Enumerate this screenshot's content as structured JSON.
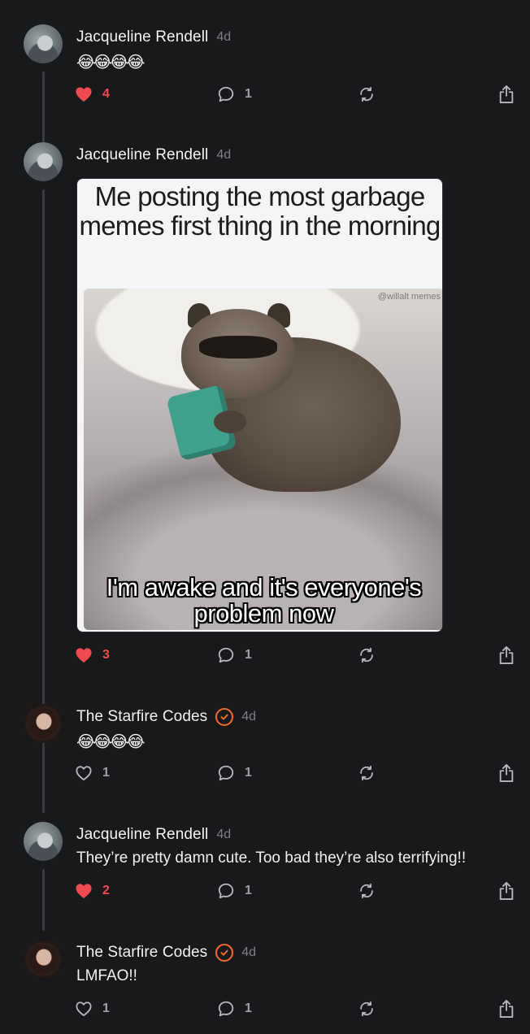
{
  "colors": {
    "background": "#18191b",
    "like_active": "#ef4a4f",
    "verified": "#f26a2b",
    "muted": "#7d7f84"
  },
  "posts": [
    {
      "author": "Jacqueline Rendell",
      "time": "4d",
      "text": "😂😂😂😂",
      "likes": "4",
      "replies": "1",
      "liked": true,
      "verified": false
    },
    {
      "author": "Jacqueline Rendell",
      "time": "4d",
      "text": "",
      "likes": "3",
      "replies": "1",
      "liked": true,
      "verified": false,
      "image": {
        "top_caption": "Me posting the most garbage memes first thing in the morning",
        "watermark": "@willalt memes",
        "bottom_caption": "I'm awake and it's everyone's problem now"
      }
    },
    {
      "author": "The Starfire Codes",
      "time": "4d",
      "text": "😂😂😂😂",
      "likes": "1",
      "replies": "1",
      "liked": false,
      "verified": true
    },
    {
      "author": "Jacqueline Rendell",
      "time": "4d",
      "text": "They’re pretty damn cute. Too bad they’re also terrifying!!",
      "likes": "2",
      "replies": "1",
      "liked": true,
      "verified": false
    },
    {
      "author": "The Starfire Codes",
      "time": "4d",
      "text": "LMFAO!!",
      "likes": "1",
      "replies": "1",
      "liked": false,
      "verified": true
    }
  ]
}
